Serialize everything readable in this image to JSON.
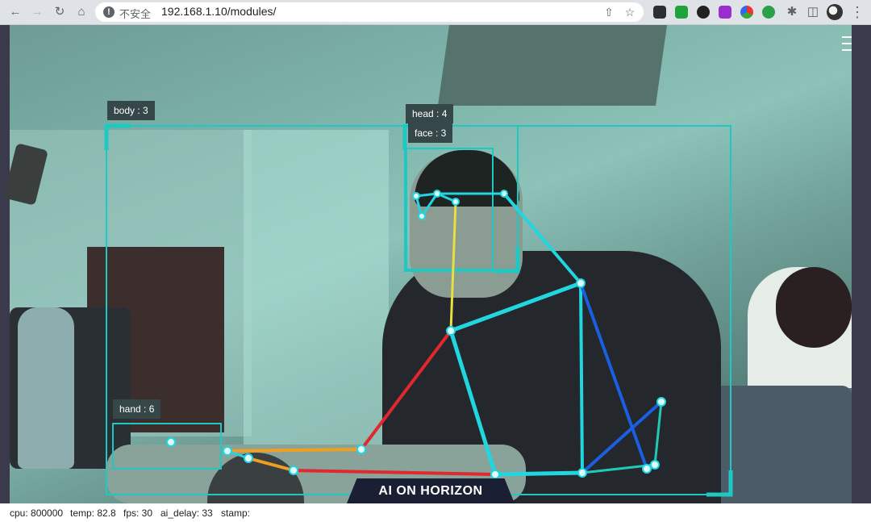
{
  "browser": {
    "insecure_label": "不安全",
    "url": "192.168.1.10/modules/"
  },
  "labels": {
    "body": "body : 3",
    "head": "head : 4",
    "face": "face : 3",
    "hand": "hand : 6"
  },
  "logo": "AI ON HORIZON",
  "status": {
    "cpu": "cpu: 800000",
    "temp": "temp: 82.8",
    "fps": "fps: 30",
    "ai_delay": "ai_delay: 33",
    "stamp": "stamp:"
  },
  "colors": {
    "box": "#1fc9c3",
    "skeleton_cyan": "#22d6e0",
    "skeleton_blue": "#1a5fe0",
    "skeleton_red": "#e0282e",
    "skeleton_orange": "#f0a020",
    "skeleton_yellow": "#e8e040"
  }
}
